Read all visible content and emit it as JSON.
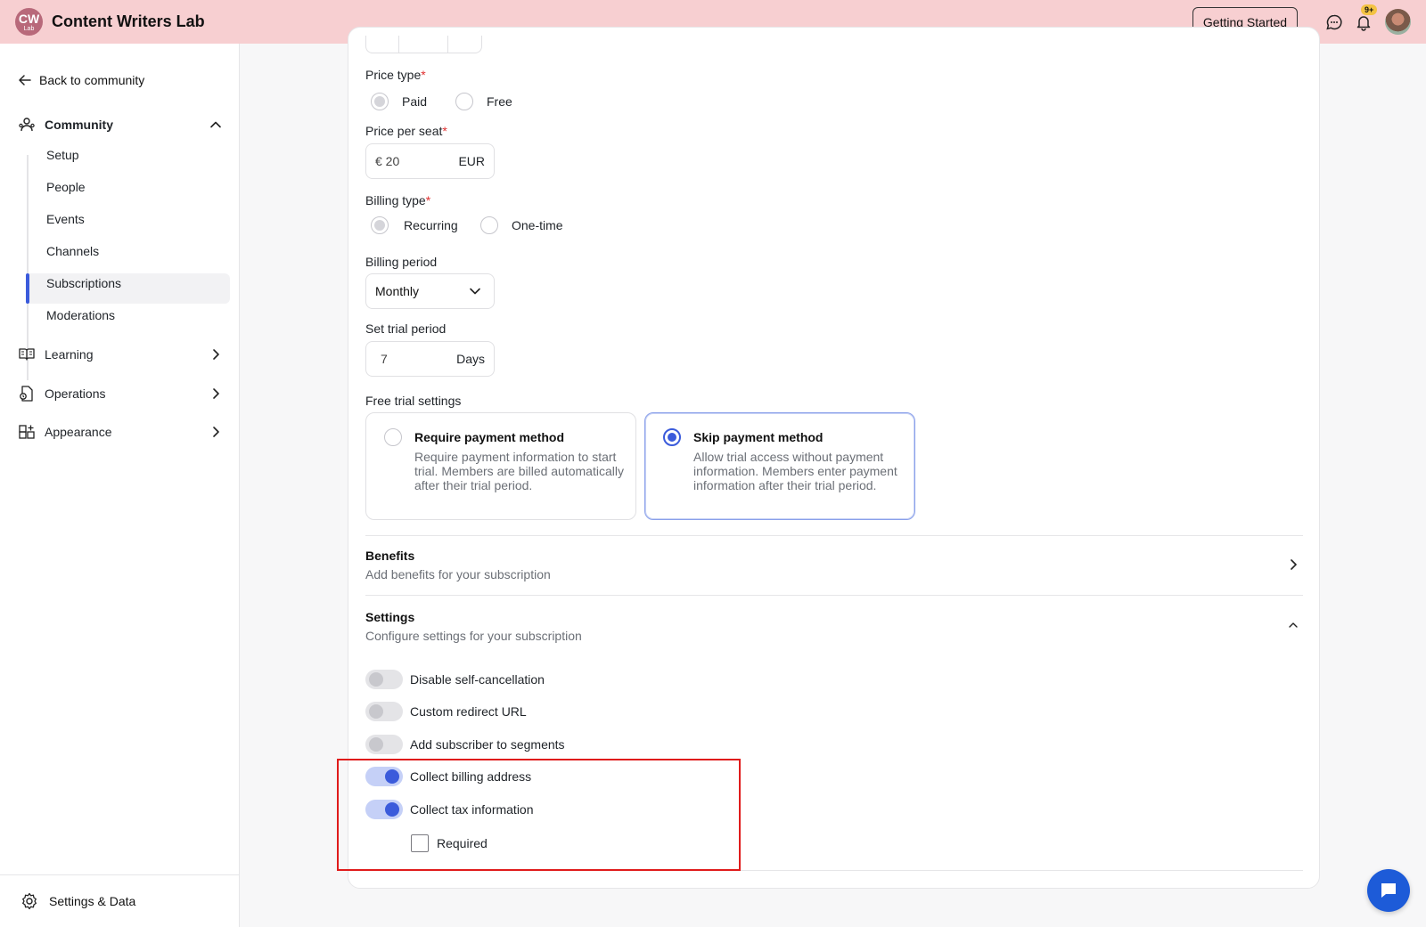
{
  "header": {
    "logo_line1": "CW",
    "logo_line2": "Lab",
    "app_title": "Content Writers Lab",
    "getting_started_label": "Getting Started",
    "notification_badge": "9+",
    "icons": [
      "chat-icon",
      "bell-icon",
      "avatar"
    ]
  },
  "sidebar": {
    "back_label": "Back to community",
    "community_label": "Community",
    "sub_items": [
      {
        "label": "Setup"
      },
      {
        "label": "People"
      },
      {
        "label": "Events"
      },
      {
        "label": "Channels"
      },
      {
        "label": "Subscriptions",
        "active": true
      },
      {
        "label": "Moderations"
      }
    ],
    "groups": [
      {
        "label": "Learning",
        "icon": "book-icon"
      },
      {
        "label": "Operations",
        "icon": "operations-icon"
      },
      {
        "label": "Appearance",
        "icon": "grid-plus-icon"
      }
    ],
    "footer_label": "Settings & Data"
  },
  "form": {
    "price_type_label": "Price type",
    "required_mark": "*",
    "price_type_options": [
      "Paid",
      "Free"
    ],
    "price_per_seat_label": "Price per seat",
    "price_value": "€ 20",
    "price_currency": "EUR",
    "billing_type_label": "Billing type",
    "billing_type_options": [
      "Recurring",
      "One-time"
    ],
    "billing_period_label": "Billing period",
    "billing_period_value": "Monthly",
    "trial_period_label": "Set trial period",
    "trial_period_value": "7",
    "trial_period_unit": "Days",
    "free_trial_label": "Free trial settings",
    "trial_options": [
      {
        "title": "Require payment method",
        "desc": "Require payment information to start trial. Members are billed automatically after their trial period.",
        "selected": false
      },
      {
        "title": "Skip payment method",
        "desc": "Allow trial access without payment information. Members enter payment information after their trial period.",
        "selected": true
      }
    ]
  },
  "benefits": {
    "title": "Benefits",
    "subtitle": "Add benefits for your subscription"
  },
  "settings": {
    "title": "Settings",
    "subtitle": "Configure settings for your subscription",
    "toggles": [
      {
        "label": "Disable self-cancellation",
        "on": false
      },
      {
        "label": "Custom redirect URL",
        "on": false
      },
      {
        "label": "Add subscriber to segments",
        "on": false
      },
      {
        "label": "Collect billing address",
        "on": true
      },
      {
        "label": "Collect tax information",
        "on": true
      }
    ],
    "required_checkbox_label": "Required",
    "required_checked": false
  },
  "colors": {
    "accent": "#3b5bdb",
    "topbar": "#f7cfd1",
    "highlight": "#e01b1b"
  }
}
